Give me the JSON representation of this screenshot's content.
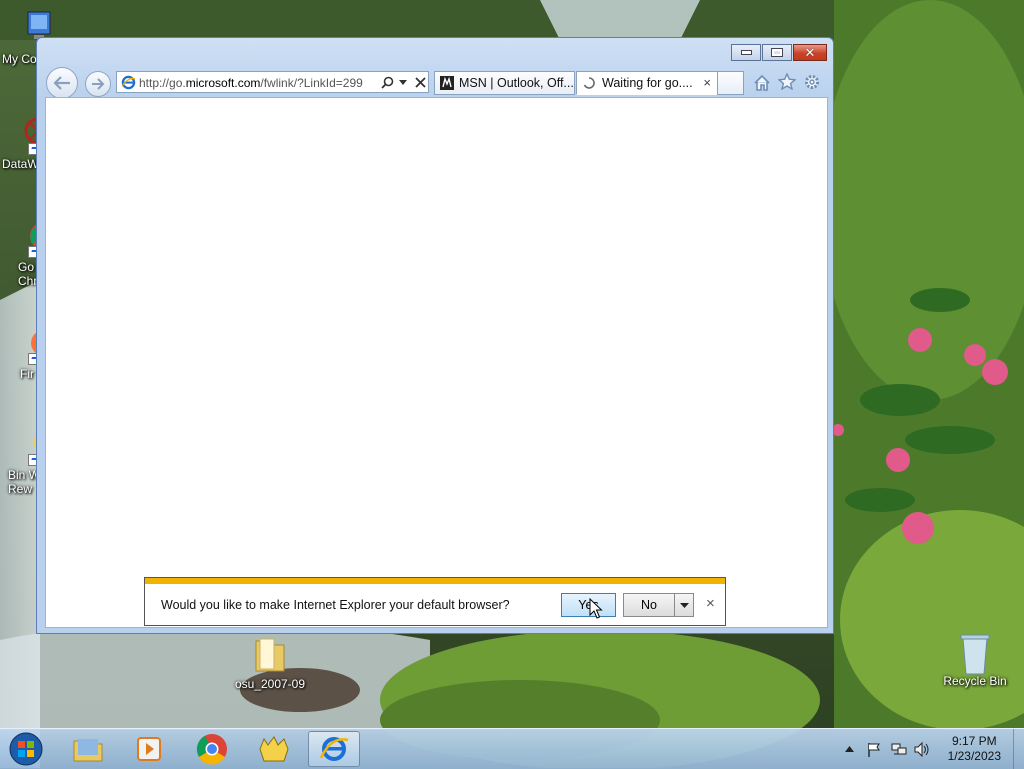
{
  "desktop": {
    "icons": [
      {
        "label": "My Co",
        "icon": "computer-icon"
      },
      {
        "label": "DataW",
        "icon": "datawrapper-icon"
      },
      {
        "label": "Go\nChr",
        "icon": "chrome-icon"
      },
      {
        "label": "Fir",
        "icon": "firefox-icon"
      },
      {
        "label": "Bin W\nRew",
        "icon": "bin-weevils-icon"
      },
      {
        "label": "osu_2007-09",
        "icon": "folder-icon"
      },
      {
        "label": "Recycle Bin",
        "icon": "recycle-bin-icon"
      }
    ]
  },
  "browser": {
    "address": {
      "prefix": "http://go.",
      "domain": "microsoft.com",
      "rest": "/fwlink/?LinkId=299"
    },
    "tabs": [
      {
        "label": "MSN | Outlook, Off...",
        "icon": "msn-icon"
      },
      {
        "label": "Waiting for go....",
        "icon": "loading-icon",
        "close": "×"
      }
    ],
    "toolbar_icons": [
      "home-icon",
      "favorites-star-icon",
      "settings-gear-icon"
    ]
  },
  "notification": {
    "message": "Would you like to make Internet Explorer your default browser?",
    "yes_label": "Yes",
    "no_label": "No",
    "close": "×"
  },
  "taskbar": {
    "items": [
      "start-orb-icon",
      "file-explorer-icon",
      "media-player-icon",
      "chrome-icon",
      "bin-weevils-icon",
      "internet-explorer-icon"
    ],
    "clock_time": "9:17 PM",
    "clock_date": "1/23/2023"
  },
  "colors": {
    "notify_stripe": "#f0b400",
    "ie_blue": "#1b6fd6"
  }
}
